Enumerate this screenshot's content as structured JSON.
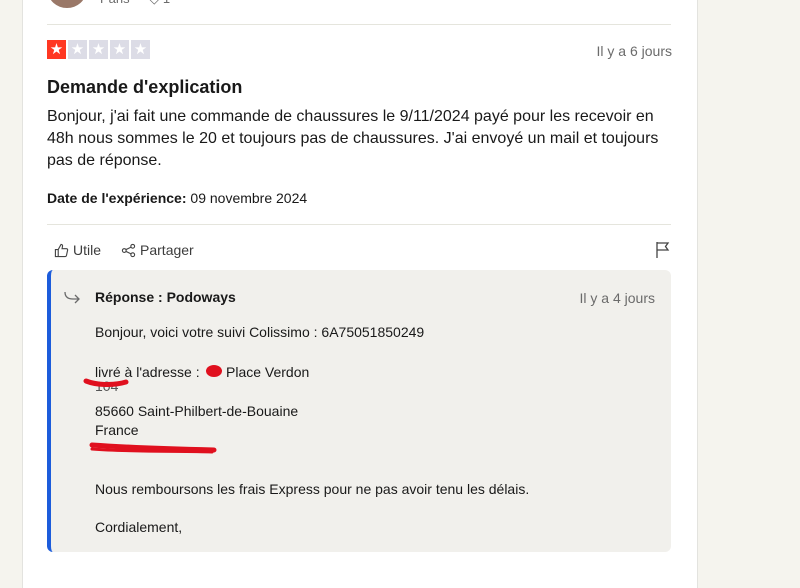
{
  "review": {
    "rating": 1,
    "rating_max": 5,
    "date": "Il y a 6 jours",
    "title": "Demande d'explication",
    "text": "Bonjour, j'ai fait une commande de chaussures le 9/11/2024 payé pour les recevoir en 48h nous sommes le 20 et toujours pas de chaussures. J'ai envoyé un mail et toujours pas de réponse.",
    "experience_label": "Date de l'expérience:",
    "experience_date": "09 novembre 2024"
  },
  "actions": {
    "useful_label": "Utile",
    "share_label": "Partager"
  },
  "reply": {
    "title": "Réponse : Podoways",
    "date": "Il y a 4 jours",
    "line_1": "Bonjour, voici votre suivi Colissimo : 6A75051850249",
    "line_2": "livré à l'adresse :",
    "line_2b": "Place Verdon",
    "line_3": "85660 Saint-Philbert-de-Bouaine",
    "line_4": "France",
    "line_5": "Nous remboursons les frais Express pour ne pas avoir tenu les délais.",
    "line_6": "Cordialement,"
  },
  "colors": {
    "star_on": "#ff3722",
    "star_off": "#dcdce6",
    "reply_accent": "#1c5cdb",
    "redaction": "#e0101e"
  }
}
